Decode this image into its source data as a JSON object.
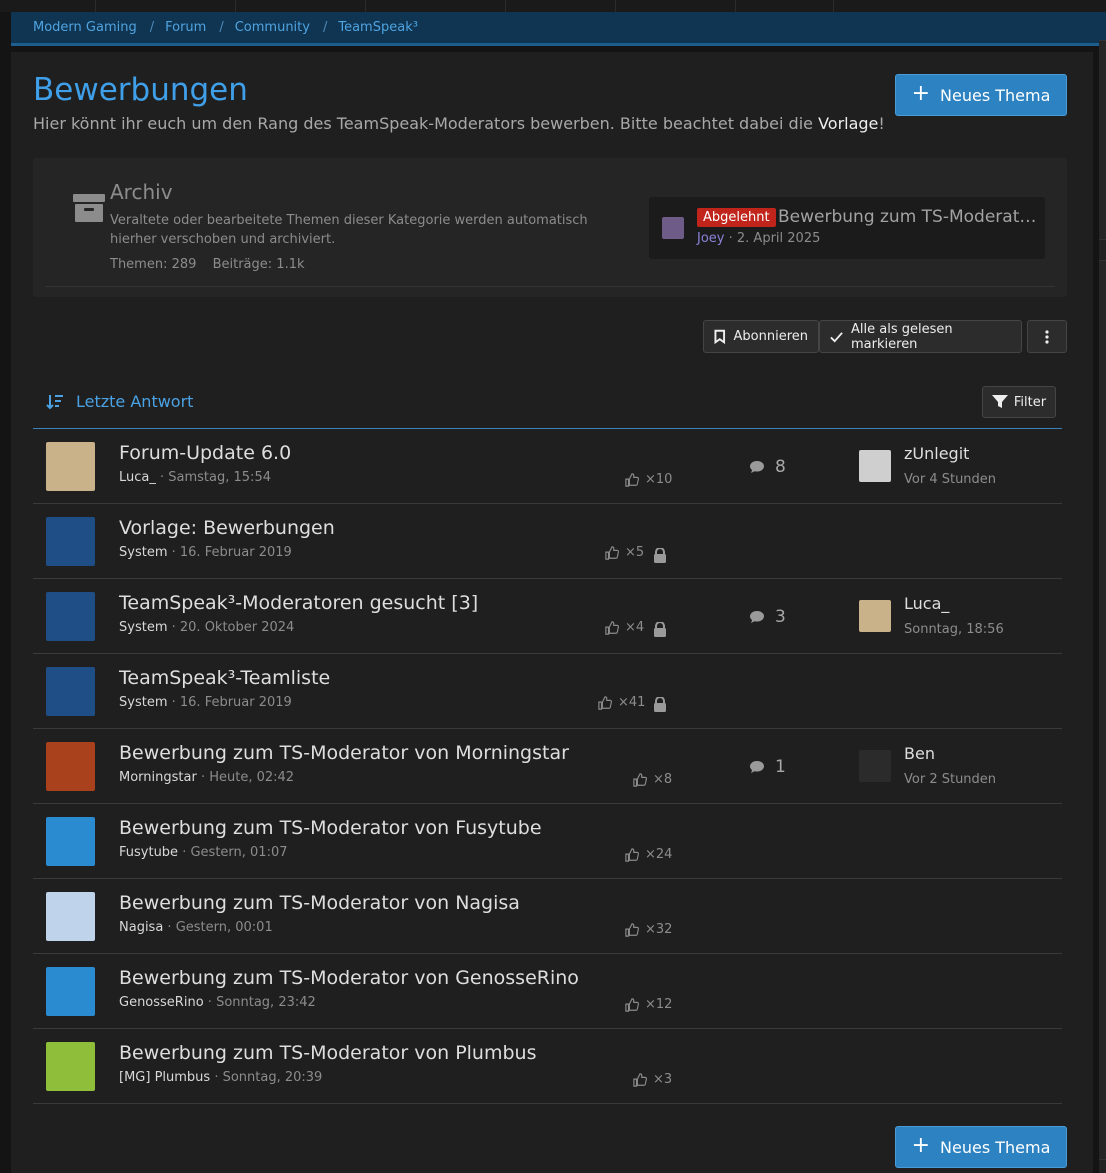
{
  "breadcrumbs": [
    "Modern Gaming",
    "Forum",
    "Community",
    "TeamSpeak³"
  ],
  "page": {
    "title": "Bewerbungen",
    "description_before": "Hier könnt ihr euch um den Rang des TeamSpeak-Moderators bewerben. Bitte beachtet dabei die ",
    "description_link": "Vorlage",
    "description_after": "!"
  },
  "new_thread_label": "Neues Thema",
  "archive": {
    "title": "Archiv",
    "description": "Veraltete oder bearbeitete Themen dieser Kategorie werden automatisch hierher verschoben und archiviert.",
    "threads_label": "Themen:",
    "threads_value": "289",
    "posts_label": "Beiträge:",
    "posts_value": "1.1k",
    "last_post": {
      "badge": "Abgelehnt",
      "title": "Bewerbung zum TS-Moderator von Joey",
      "user": "Joey",
      "date": "2. April 2025"
    }
  },
  "toolbar": {
    "subscribe": "Abonnieren",
    "mark_read": "Alle als gelesen markieren"
  },
  "sort_label": "Letzte Antwort",
  "filter_label": "Filter",
  "threads": [
    {
      "title": "Forum-Update 6.0",
      "author": "Luca_",
      "date": "Samstag, 15:54",
      "likes": "×10",
      "replies": "8",
      "last_user": "zUnlegit",
      "last_time": "Vor 4 Stunden",
      "avatar_color": "#c9b28a",
      "last_avatar_color": "#cfcfcf"
    },
    {
      "title": "Vorlage: Bewerbungen",
      "author": "System",
      "date": "16. Februar 2019",
      "likes": "×5",
      "locked": true,
      "avatar_color": "#1f4e86"
    },
    {
      "title": "TeamSpeak³-Moderatoren gesucht [3]",
      "author": "System",
      "date": "20. Oktober 2024",
      "likes": "×4",
      "locked": true,
      "replies": "3",
      "last_user": "Luca_",
      "last_time": "Sonntag, 18:56",
      "avatar_color": "#1f4e86",
      "last_avatar_color": "#c9b28a"
    },
    {
      "title": "TeamSpeak³-Teamliste",
      "author": "System",
      "date": "16. Februar 2019",
      "likes": "×41",
      "locked": true,
      "avatar_color": "#1f4e86"
    },
    {
      "title": "Bewerbung zum TS-Moderator von Morningstar",
      "author": "Morningstar",
      "date": "Heute, 02:42",
      "likes": "×8",
      "replies": "1",
      "last_user": "Ben",
      "last_time": "Vor 2 Stunden",
      "avatar_color": "#a8411c",
      "last_avatar_color": "#2b2b2b"
    },
    {
      "title": "Bewerbung zum TS-Moderator von Fusytube",
      "author": "Fusytube",
      "date": "Gestern, 01:07",
      "likes": "×24",
      "avatar_color": "#2a8bd0"
    },
    {
      "title": "Bewerbung zum TS-Moderator von Nagisa",
      "author": "Nagisa",
      "date": "Gestern, 00:01",
      "likes": "×32",
      "avatar_color": "#bfd3ea"
    },
    {
      "title": "Bewerbung zum TS-Moderator von GenosseRino",
      "author": "GenosseRino",
      "date": "Sonntag, 23:42",
      "likes": "×12",
      "avatar_color": "#2a8bd0"
    },
    {
      "title": "Bewerbung zum TS-Moderator von Plumbus",
      "author": "[MG] Plumbus",
      "date": "Sonntag, 20:39",
      "likes": "×3",
      "avatar_color": "#8fbf3a"
    }
  ]
}
